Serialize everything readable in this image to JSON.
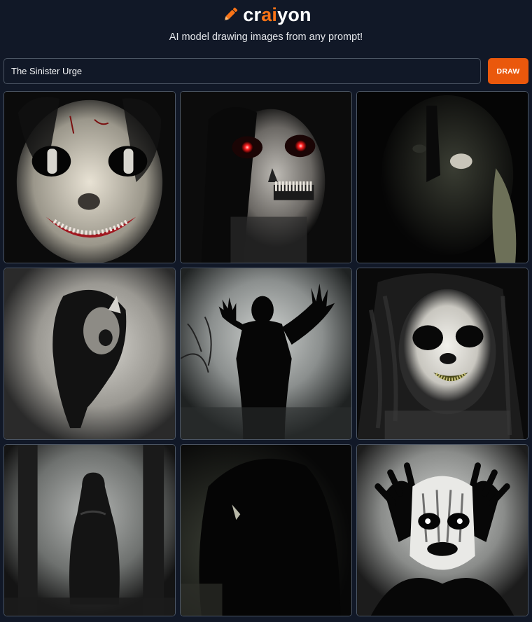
{
  "app": {
    "name_part1": "cr",
    "name_accent": "ai",
    "name_part2": "yon",
    "tagline": "AI model drawing images from any prompt!",
    "brand_color": "#f97316",
    "button_color": "#ea580c",
    "background_color": "#111827"
  },
  "prompt": {
    "value": "The Sinister Urge"
  },
  "draw_button": {
    "label": "DRAW"
  },
  "images": [
    {
      "subject": "grinning-clown-face"
    },
    {
      "subject": "red-eyed-skull-face"
    },
    {
      "subject": "shadowy-figure-with-glowing-mouth"
    },
    {
      "subject": "shadow-profile-with-skull"
    },
    {
      "subject": "silhouette-with-raised-hands"
    },
    {
      "subject": "pale-grinning-face-with-hair"
    },
    {
      "subject": "hooded-figure-in-fog"
    },
    {
      "subject": "dark-hooded-shape"
    },
    {
      "subject": "face-with-glowing-eyes-and-claws"
    }
  ]
}
